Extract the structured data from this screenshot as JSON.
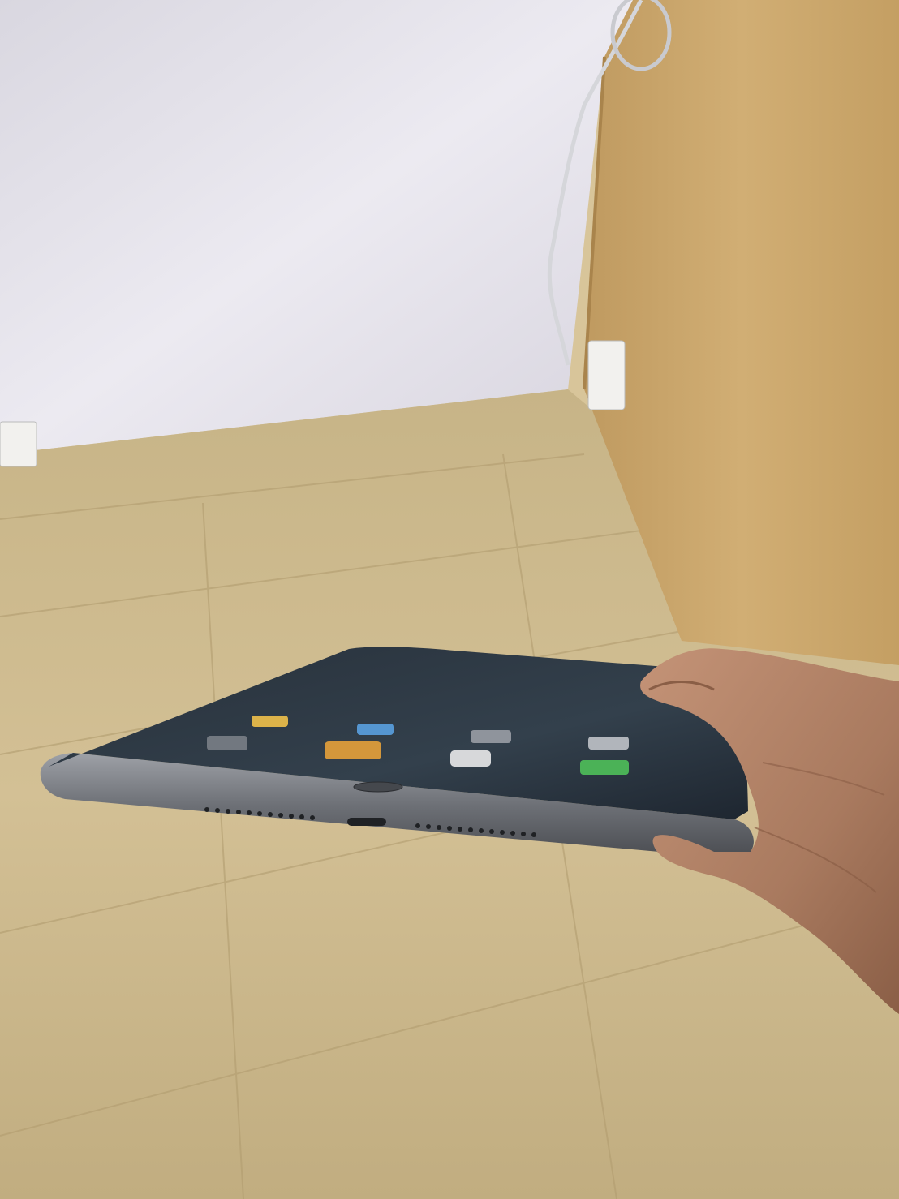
{
  "scene": {
    "subject": "tablet",
    "colors": {
      "wall": "#e6e4ec",
      "wall_shadow": "#c9c6d2",
      "floor": "#cdb98c",
      "floor_dark": "#a9946a",
      "cabinet": "#c9a56b",
      "cabinet_dark": "#a98349",
      "tablet_body": "#5b5d62",
      "tablet_edge": "#8c8f95",
      "screen": "#2a3340",
      "skin": "#b88a6f",
      "skin_dark": "#8c5f47"
    },
    "icons": [
      "home-button-icon",
      "lightning-port-icon",
      "speaker-grille-icon",
      "power-outlet-icon"
    ]
  }
}
